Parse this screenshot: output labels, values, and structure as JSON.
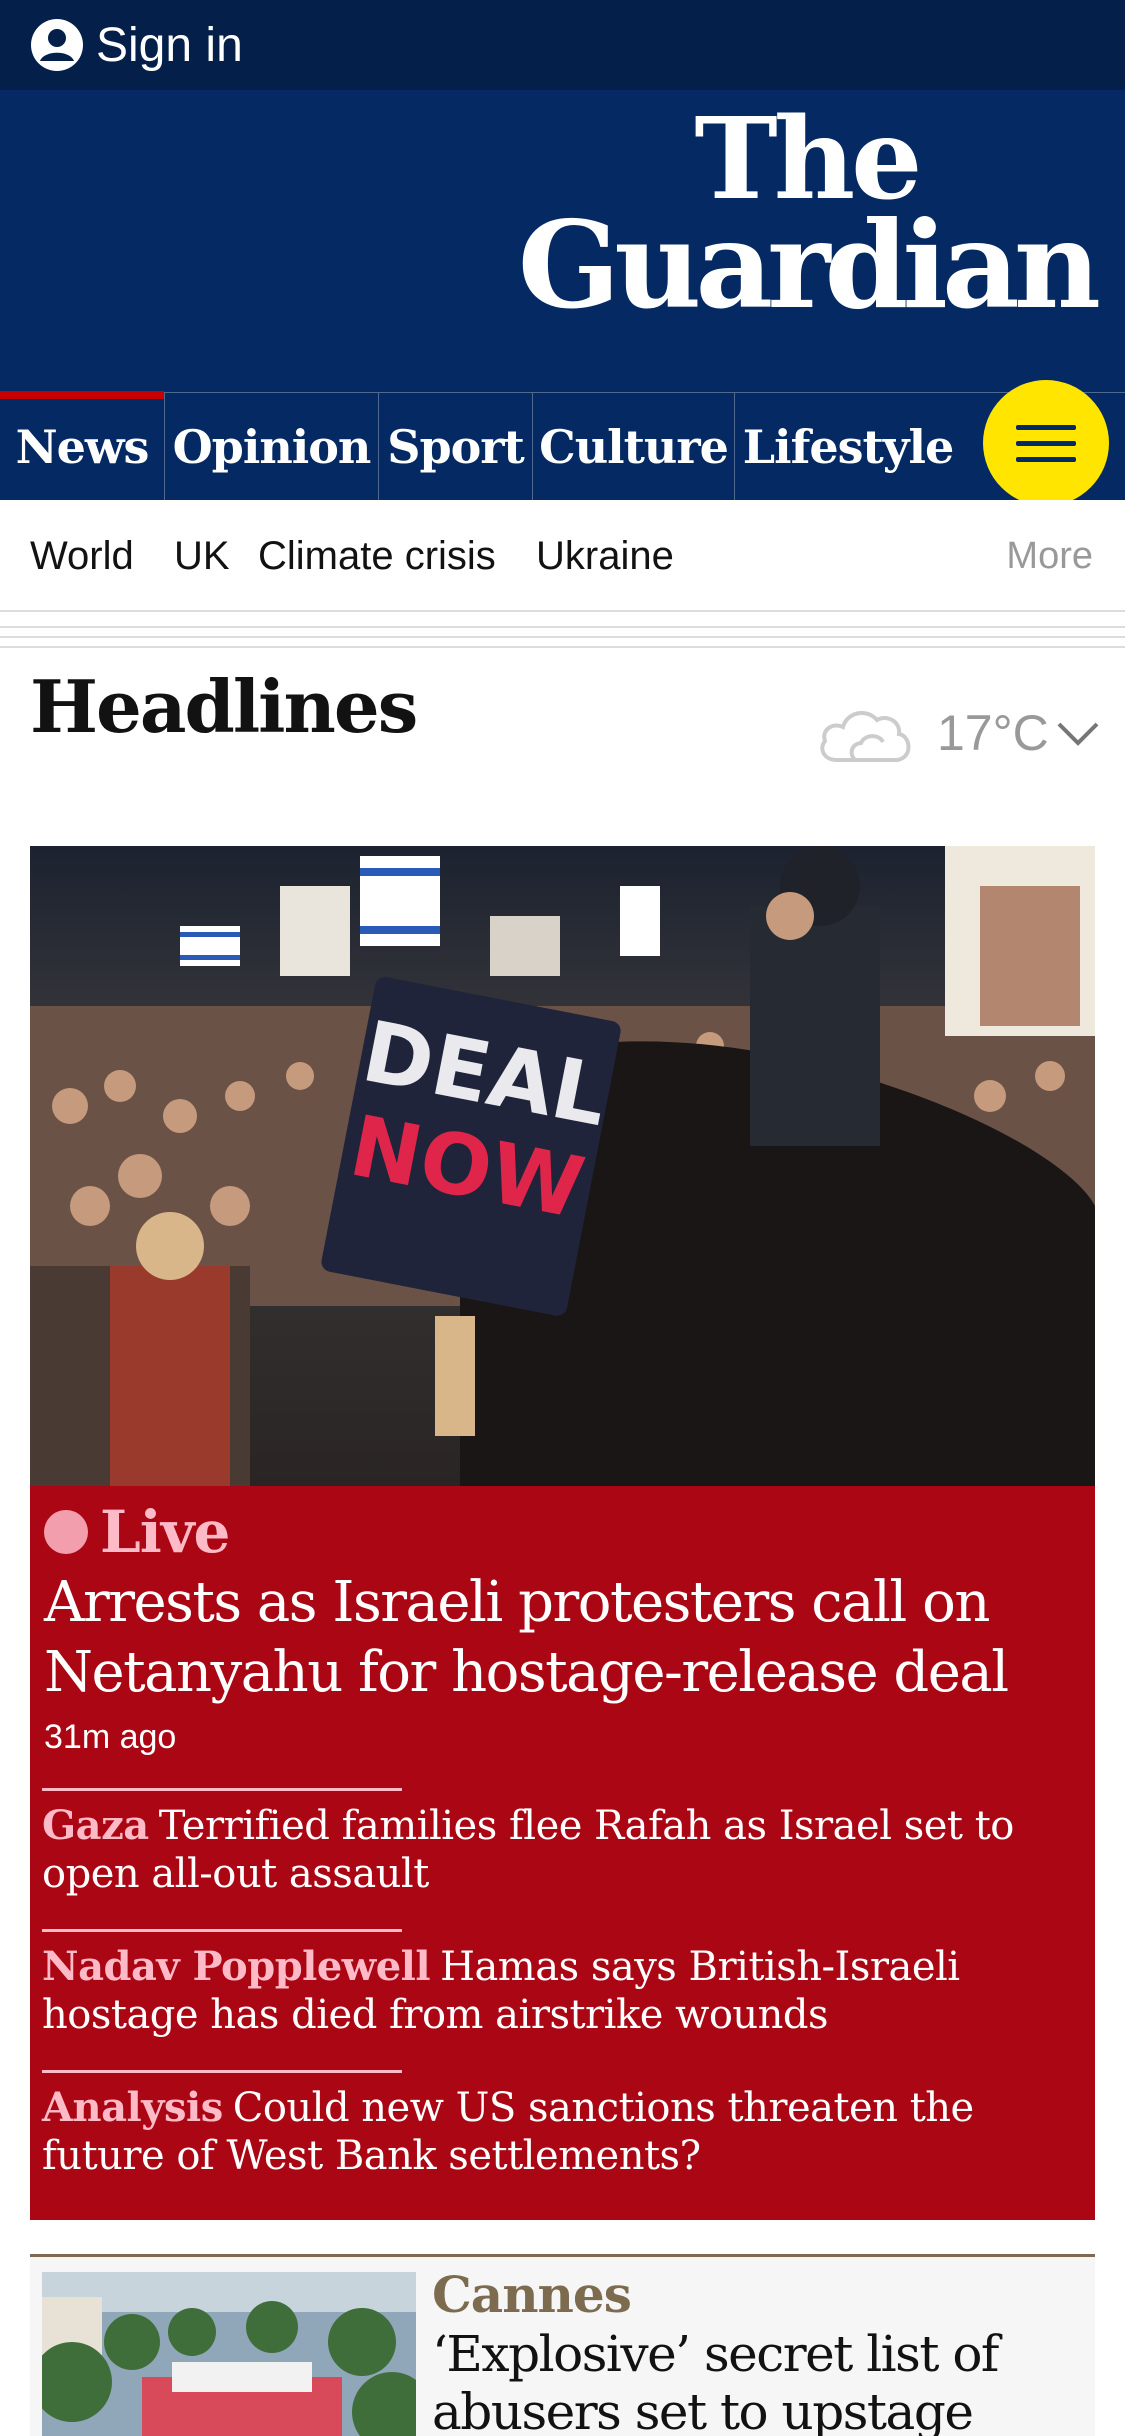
{
  "colors": {
    "brand_dark": "#041f4a",
    "brand": "#052962",
    "news_red": "#c70000",
    "live_card": "#ab0613",
    "menu_yellow": "#ffe500",
    "culture_brown": "#7d6b50"
  },
  "topbar": {
    "signin_icon": "user-icon",
    "signin_label": "Sign in"
  },
  "masthead": {
    "logo_line1": "The",
    "logo_line2": "Guardian"
  },
  "pillars": [
    {
      "label": "News",
      "active": true
    },
    {
      "label": "Opinion"
    },
    {
      "label": "Sport"
    },
    {
      "label": "Culture"
    },
    {
      "label": "Lifestyle"
    }
  ],
  "menu_icon": "hamburger-menu-icon",
  "subnav": {
    "items": [
      "World",
      "UK",
      "Climate crisis",
      "Ukraine"
    ],
    "more": "More"
  },
  "headlines": {
    "title": "Headlines",
    "weather_icon": "cloud-icon",
    "temperature": "17°C"
  },
  "lead": {
    "image_alt": "Protesters holding sign",
    "sign_line1": "DEAL",
    "sign_line2": "NOW",
    "kicker": "Live",
    "headline": "Arrests as Israeli protesters call on Netanyahu for hostage-release deal",
    "time": "31m ago",
    "sublinks": [
      {
        "kicker": "Gaza",
        "text": "Terrified families flee Rafah as Israel set to open all-out assault"
      },
      {
        "kicker": "Nadav Popplewell",
        "text": "Hamas says British-Israeli hostage has died from airstrike wounds"
      },
      {
        "kicker": "Analysis",
        "text": "Could new US sanctions threaten the future of West Bank settlements?"
      }
    ]
  },
  "card2": {
    "kicker": "Cannes",
    "headline": "‘Explosive’ secret list of abusers set to upstage"
  }
}
